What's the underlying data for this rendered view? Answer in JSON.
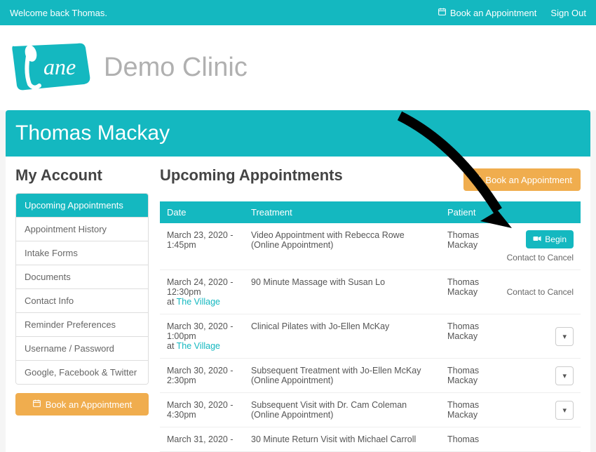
{
  "topbar": {
    "welcome": "Welcome back Thomas.",
    "book": "Book an Appointment",
    "signout": "Sign Out"
  },
  "header": {
    "clinic_name": "Demo Clinic"
  },
  "page_title": "Thomas Mackay",
  "sidebar": {
    "heading": "My Account",
    "items": [
      {
        "label": "Upcoming Appointments",
        "active": true
      },
      {
        "label": "Appointment History",
        "active": false
      },
      {
        "label": "Intake Forms",
        "active": false
      },
      {
        "label": "Documents",
        "active": false
      },
      {
        "label": "Contact Info",
        "active": false
      },
      {
        "label": "Reminder Preferences",
        "active": false
      },
      {
        "label": "Username / Password",
        "active": false
      },
      {
        "label": "Google, Facebook & Twitter",
        "active": false
      }
    ],
    "book_btn": "Book an Appointment"
  },
  "main": {
    "heading": "Upcoming Appointments",
    "book_btn": "Book an Appointment",
    "columns": {
      "date": "Date",
      "treatment": "Treatment",
      "patient": "Patient"
    },
    "begin_label": "Begin",
    "contact_cancel": "Contact to Cancel",
    "at_prefix": "at ",
    "rows": [
      {
        "date": "March 23, 2020 - 1:45pm",
        "treatment": "Video Appointment with Rebecca Rowe",
        "treatment_sub": "(Online Appointment)",
        "patient": "Thomas Mackay",
        "action": "begin_cancel"
      },
      {
        "date": "March 24, 2020 - 12:30pm",
        "location": "The Village",
        "treatment": "90 Minute Massage with Susan Lo",
        "patient": "Thomas Mackay",
        "action": "cancel"
      },
      {
        "date": "March 30, 2020 - 1:00pm",
        "location": "The Village",
        "treatment": "Clinical Pilates with Jo-Ellen McKay",
        "patient": "Thomas Mackay",
        "action": "caret"
      },
      {
        "date": "March 30, 2020 - 2:30pm",
        "treatment": "Subsequent Treatment with Jo-Ellen McKay",
        "treatment_sub": "(Online Appointment)",
        "patient": "Thomas Mackay",
        "action": "caret"
      },
      {
        "date": "March 30, 2020 - 4:30pm",
        "treatment": "Subsequent Visit with Dr. Cam Coleman",
        "treatment_sub": "(Online Appointment)",
        "patient": "Thomas Mackay",
        "action": "caret"
      },
      {
        "date": "March 31, 2020 -",
        "treatment": "30 Minute Return Visit with Michael Carroll",
        "patient": "Thomas",
        "action": ""
      }
    ]
  }
}
